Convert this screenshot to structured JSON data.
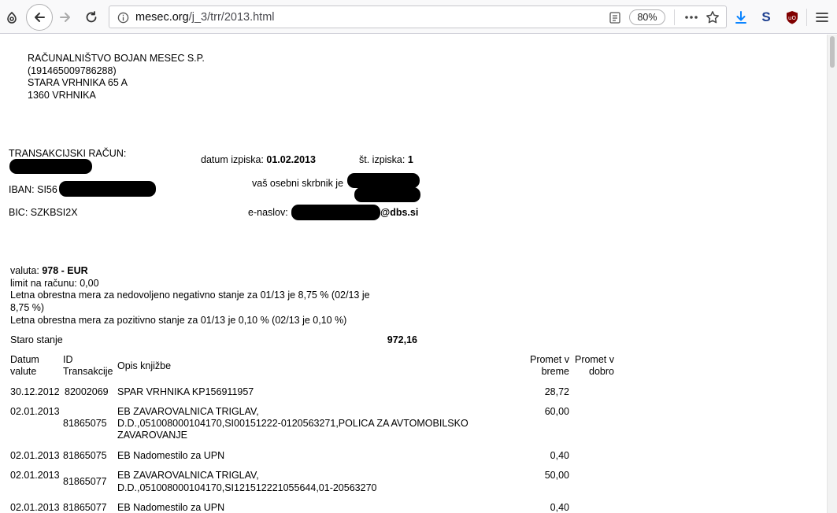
{
  "browser": {
    "url_host": "mesec.org",
    "url_path": "/j_3/trr/2013.html",
    "zoom": "80%"
  },
  "company": {
    "name": "RAČUNALNIŠTVO BOJAN MESEC S.P.",
    "tax_id": "(191465009786288)",
    "street": "STARA VRHNIKA 65 A",
    "city": "1360 VRHNIKA"
  },
  "account": {
    "trr_label": "TRANSAKCIJSKI RAČUN:",
    "iban_label": "IBAN: SI56",
    "bic": "BIC: SZKBSI2X",
    "date_label": "datum izpiska:",
    "date_value": "01.02.2013",
    "no_label": "št. izpiska:",
    "no_value": "1",
    "advisor_label": "vaš osebni skrbnik je",
    "email_label": "e-naslov:",
    "email_domain": "@dbs.si"
  },
  "info": {
    "currency_label": "valuta:",
    "currency_value": "978 - EUR",
    "limit": "limit na računu: 0,00",
    "negative_rate_1": "Letna obrestna mera za nedovoljeno negativno stanje za 01/13 je 8,75 % (02/13 je",
    "negative_rate_2": "8,75 %)",
    "positive_rate": "Letna obrestna mera za pozitivno stanje za 01/13 je 0,10 % (02/13 je 0,10 %)"
  },
  "balance": {
    "label": "Staro stanje",
    "value": "972,16"
  },
  "table": {
    "headers": {
      "date_1": "Datum",
      "date_2": "valute",
      "id_1": "ID",
      "id_2": "Transakcije",
      "desc": "Opis knjižbe",
      "debit_1": "Promet v",
      "debit_2": "breme",
      "credit_1": "Promet v",
      "credit_2": "dobro"
    },
    "rows": [
      {
        "date": "30.12.2012",
        "id": "82002069",
        "desc": [
          "SPAR VRHNIKA KP156911957"
        ],
        "debit": "28,72"
      },
      {
        "date": "02.01.2013",
        "id": "81865075",
        "desc": [
          "EB ZAVAROVALNICA TRIGLAV,",
          "D.D.,051008000104170,SI00151222-0120563271,POLICA ZA AVTOMOBILSKO",
          "ZAVAROVANJE"
        ],
        "debit": "60,00"
      },
      {
        "date": "02.01.2013",
        "id": "81865075",
        "desc": [
          "EB Nadomestilo za UPN"
        ],
        "debit": "0,40"
      },
      {
        "date": "02.01.2013",
        "id": "81865077",
        "desc": [
          "EB ZAVAROVALNICA TRIGLAV,",
          "D.D.,051008000104170,SI121512221055644,01-20563270"
        ],
        "debit": "50,00"
      },
      {
        "date": "02.01.2013",
        "id": "81865077",
        "desc": [
          "EB Nadomestilo za UPN"
        ],
        "debit": "0,40"
      }
    ]
  }
}
